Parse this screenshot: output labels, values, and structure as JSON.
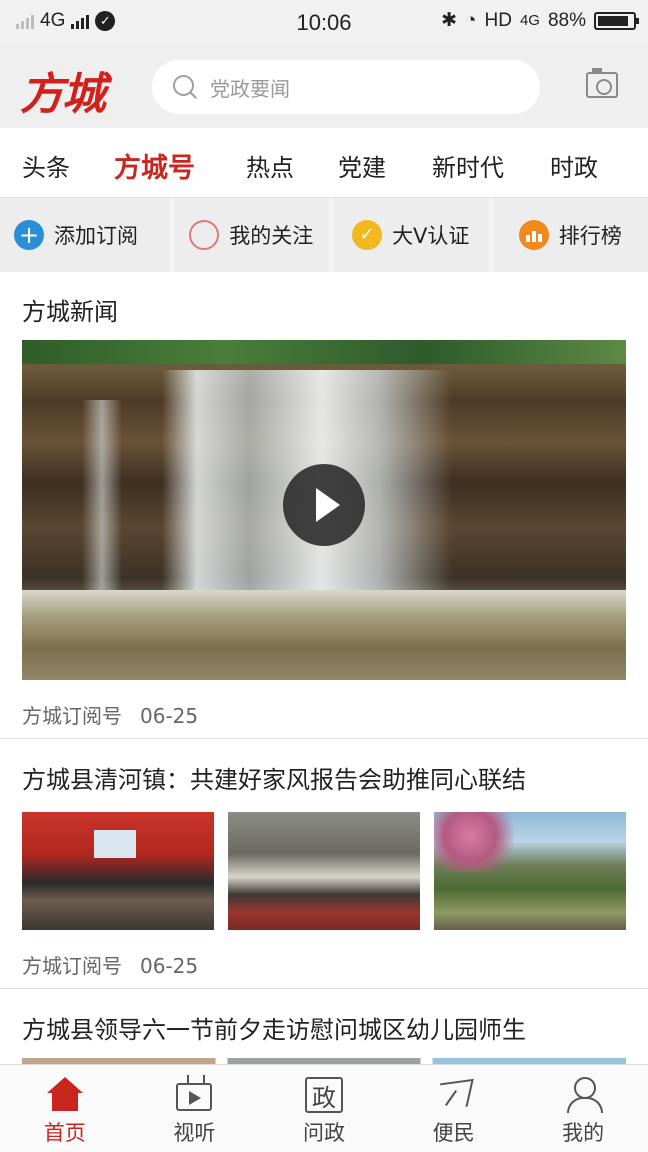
{
  "status_bar": {
    "network": "4G",
    "time": "10:06",
    "hd_label": "HD",
    "network_right": "4G",
    "battery_percent": "88%",
    "battery_level": 0.88
  },
  "header": {
    "logo_text": "方城",
    "search_placeholder": "党政要闻",
    "icons": {
      "search": "search-icon",
      "camera": "camera-icon"
    }
  },
  "tabs": [
    {
      "label": "头条"
    },
    {
      "label": "方城号",
      "active": true
    },
    {
      "label": "热点"
    },
    {
      "label": "党建"
    },
    {
      "label": "新时代"
    },
    {
      "label": "时政"
    }
  ],
  "quick_actions": [
    {
      "label": "添加订阅",
      "icon": "plus-icon"
    },
    {
      "label": "我的关注",
      "icon": "ring-icon"
    },
    {
      "label": "大V认证",
      "icon": "check-icon"
    },
    {
      "label": "排行榜",
      "icon": "rank-icon"
    }
  ],
  "feed": {
    "section_title": "方城新闻",
    "video_item": {
      "source": "方城订阅号",
      "date": "06-25"
    },
    "items": [
      {
        "title": "方城县清河镇：共建好家风报告会助推同心联结",
        "source": "方城订阅号",
        "date": "06-25"
      },
      {
        "title": "方城县领导六一节前夕走访慰问城区幼儿园师生"
      }
    ]
  },
  "bottom_nav": [
    {
      "label": "首页",
      "icon": "home-icon",
      "active": true
    },
    {
      "label": "视听",
      "icon": "tv-icon"
    },
    {
      "label": "问政",
      "icon": "zheng-icon",
      "glyph": "政"
    },
    {
      "label": "便民",
      "icon": "send-icon"
    },
    {
      "label": "我的",
      "icon": "user-icon"
    }
  ],
  "colors": {
    "accent": "#c9261f",
    "header_bg": "#efefef",
    "text": "#222222"
  }
}
